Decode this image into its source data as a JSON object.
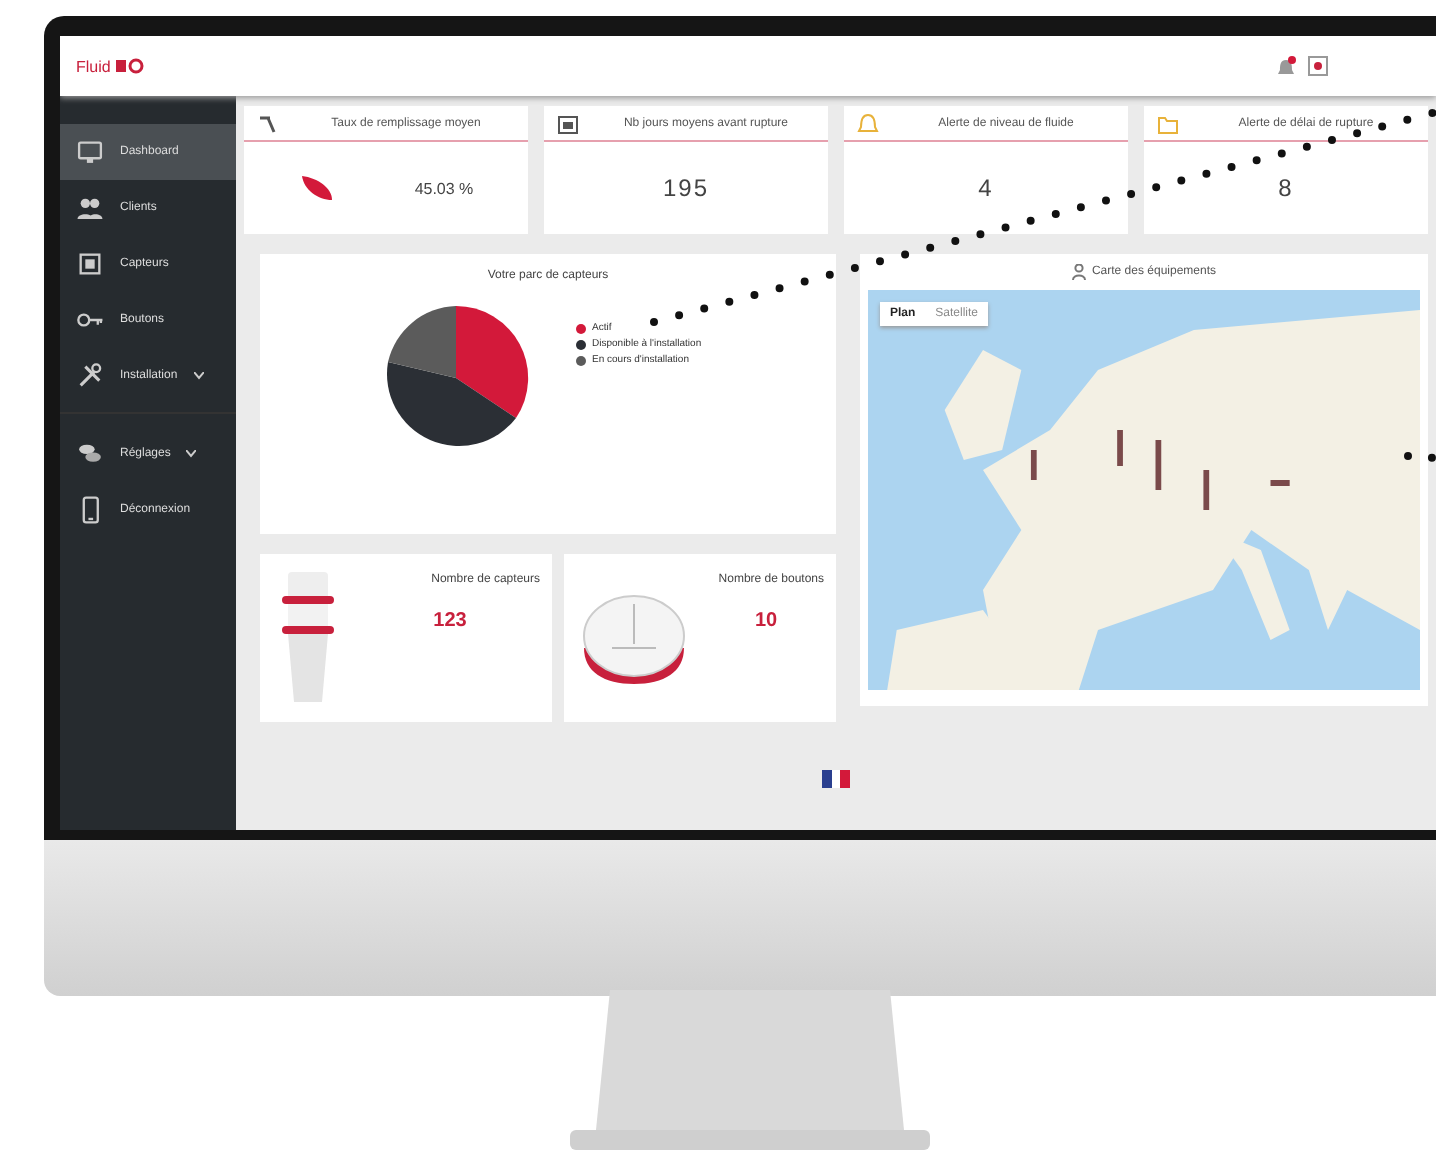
{
  "header": {
    "logo": "Fluid"
  },
  "sidebar": {
    "items": [
      {
        "label": "Dashboard",
        "selected": true,
        "kind": "link"
      },
      {
        "label": "Clients",
        "selected": false,
        "kind": "link"
      },
      {
        "label": "Capteurs",
        "selected": false,
        "kind": "link"
      },
      {
        "label": "Boutons",
        "selected": false,
        "kind": "link"
      },
      {
        "label": "Installation",
        "selected": false,
        "kind": "submenu"
      },
      {
        "label": "Réglages",
        "selected": false,
        "kind": "submenu"
      },
      {
        "label": "Déconnexion",
        "selected": false,
        "kind": "link"
      }
    ]
  },
  "stats": [
    {
      "title": "Taux de remplissage moyen",
      "value": "45.03 %"
    },
    {
      "title": "Nb jours moyens avant rupture",
      "value": "195"
    },
    {
      "title": "Alerte de niveau de fluide",
      "value": "4"
    },
    {
      "title": "Alerte de délai de rupture",
      "value": "8"
    }
  ],
  "pie_card": {
    "title": "Votre parc de capteurs",
    "legend": [
      {
        "label": "Actif",
        "color": "#d3193a"
      },
      {
        "label": "Disponible à l'installation",
        "color": "#2b2f35"
      },
      {
        "label": "En cours d'installation",
        "color": "#5b5b5b"
      }
    ]
  },
  "map_card": {
    "title": "Carte des équipements",
    "map_types": [
      {
        "label": "Plan",
        "selected": true
      },
      {
        "label": "Satellite",
        "selected": false
      }
    ]
  },
  "count_cards": [
    {
      "title": "Nombre de capteurs",
      "value": "123"
    },
    {
      "title": "Nombre de boutons",
      "value": "10"
    }
  ]
}
